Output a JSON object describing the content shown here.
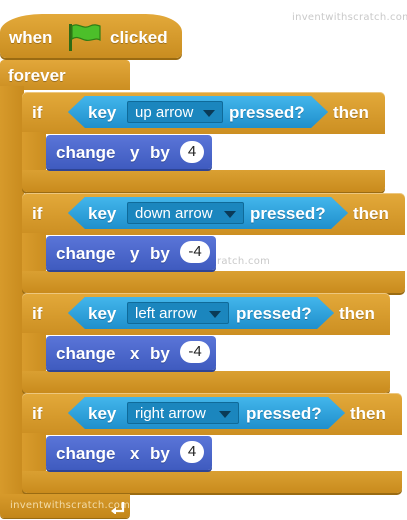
{
  "watermarks": {
    "top": "inventwithscratch.com",
    "middle": "inventwithscratch.com",
    "bottom": "inventwithscratch.com"
  },
  "hat": {
    "when": "when",
    "clicked": "clicked",
    "icon": "green-flag-icon"
  },
  "forever": {
    "label": "forever",
    "loop_icon": "loop-arrow-icon"
  },
  "if_blocks": [
    {
      "if": "if",
      "key": "key",
      "key_option": "up arrow",
      "pressed": "pressed?",
      "then": "then",
      "action": {
        "change": "change",
        "axis": "y",
        "by": "by",
        "value": "4"
      }
    },
    {
      "if": "if",
      "key": "key",
      "key_option": "down arrow",
      "pressed": "pressed?",
      "then": "then",
      "action": {
        "change": "change",
        "axis": "y",
        "by": "by",
        "value": "-4"
      }
    },
    {
      "if": "if",
      "key": "key",
      "key_option": "left arrow",
      "pressed": "pressed?",
      "then": "then",
      "action": {
        "change": "change",
        "axis": "x",
        "by": "by",
        "value": "-4"
      }
    },
    {
      "if": "if",
      "key": "key",
      "key_option": "right arrow",
      "pressed": "pressed?",
      "then": "then",
      "action": {
        "change": "change",
        "axis": "x",
        "by": "by",
        "value": "4"
      }
    }
  ],
  "colors": {
    "control": "#E1A536",
    "sensing": "#2CA5E2",
    "motion": "#4A6CD4"
  }
}
